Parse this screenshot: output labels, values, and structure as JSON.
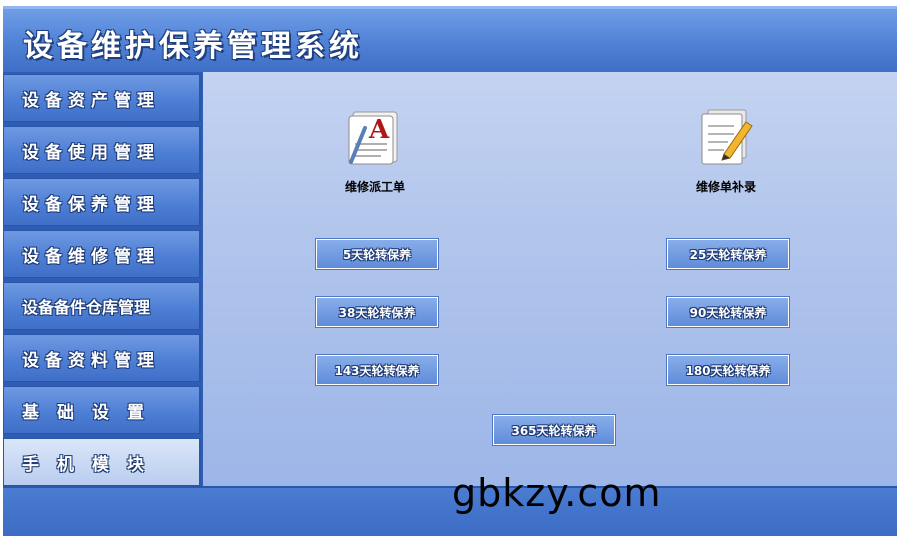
{
  "app": {
    "title": "设备维护保养管理系统"
  },
  "sidebar": {
    "items": [
      {
        "label": "设备资产管理"
      },
      {
        "label": "设备使用管理"
      },
      {
        "label": "设备保养管理"
      },
      {
        "label": "设备维修管理"
      },
      {
        "label": "设备备件仓库管理"
      },
      {
        "label": "设备资料管理"
      },
      {
        "label": "基础设置"
      },
      {
        "label": "手机模块"
      }
    ],
    "active": "手机模块"
  },
  "main": {
    "icons": [
      {
        "label": "维修派工单",
        "icon": "document-letter-icon"
      },
      {
        "label": "维修单补录",
        "icon": "document-edit-icon"
      }
    ],
    "buttons": [
      {
        "label": "5天轮转保养"
      },
      {
        "label": "25天轮转保养"
      },
      {
        "label": "38天轮转保养"
      },
      {
        "label": "90天轮转保养"
      },
      {
        "label": "143天轮转保养"
      },
      {
        "label": "180天轮转保养"
      },
      {
        "label": "365天轮转保养"
      }
    ]
  },
  "watermark": "gbkzy.com"
}
